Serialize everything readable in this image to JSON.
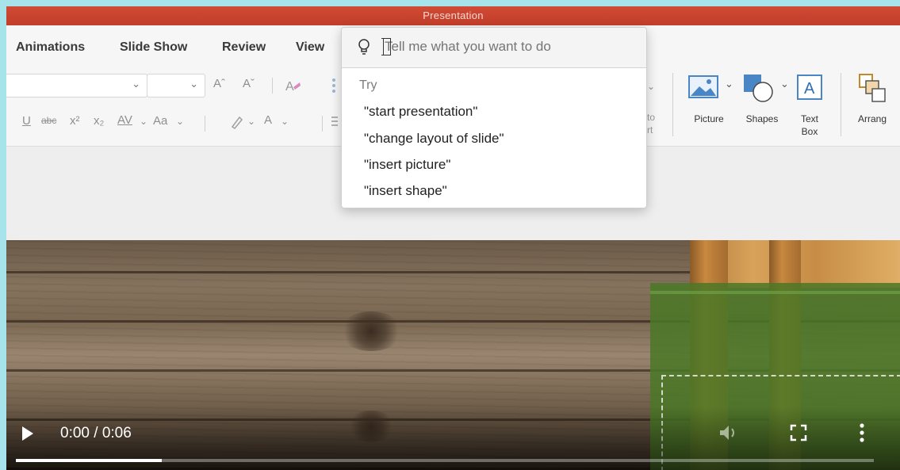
{
  "window": {
    "title": "Presentation"
  },
  "tabs": [
    "Animations",
    "Slide Show",
    "Review",
    "View"
  ],
  "ribbon": {
    "font_size_placeholder": "",
    "format_glyphs": {
      "increase_font": "Aˆ",
      "decrease_font": "Aˇ",
      "underline": "U",
      "strikethrough": "abc",
      "superscript": "x²",
      "subscript": "x₂",
      "char_spacing": "AV",
      "change_case": "Aa",
      "font_color": "A"
    },
    "cut_off_label": [
      "to",
      "rt"
    ],
    "picture_label": "Picture",
    "shapes_label": "Shapes",
    "textbox_label_1": "Text",
    "textbox_label_2": "Box",
    "arrange_label": "Arrang"
  },
  "tell_me": {
    "placeholder": "Tell me what you want to do",
    "try_label": "Try",
    "suggestions": [
      "\"start presentation\"",
      "\"change layout of slide\"",
      "\"insert picture\"",
      "\"insert shape\""
    ]
  },
  "video": {
    "time": "0:00 / 0:06",
    "progress_fraction": 0.17
  },
  "colors": {
    "titlebar": "#c9432f",
    "accent_green": "#4a7826",
    "frame_border": "#a7e3ea"
  }
}
